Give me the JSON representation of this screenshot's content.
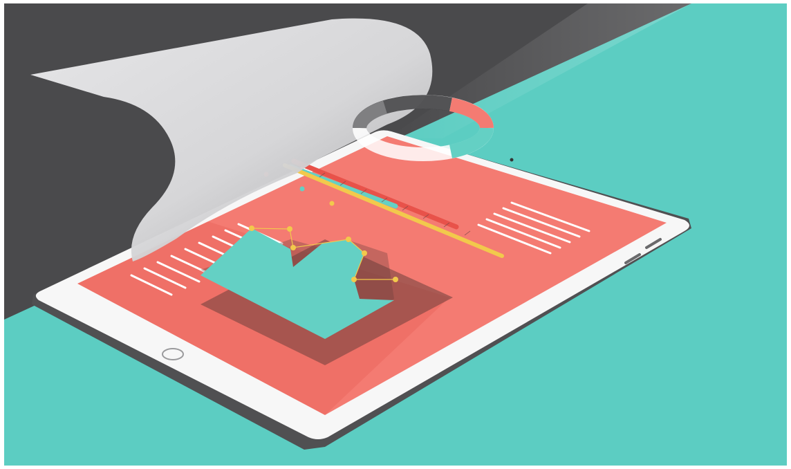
{
  "colors": {
    "background_teal": "#5ccdc2",
    "background_dark": "#4a4a4c",
    "paper": "#e8e8ea",
    "tablet_white": "#f7f7f7",
    "tablet_edge": "#505052",
    "screen_coral": "#f47b72",
    "accent_red": "#e8524a",
    "accent_teal": "#64d0c4",
    "accent_yellow": "#f2c94c",
    "shadow_dark": "#6b3f3d"
  },
  "icons": {
    "home_button": "home-button-icon",
    "camera": "camera-icon",
    "donut_chart": "donut-chart-icon",
    "area_chart": "area-chart-icon"
  }
}
